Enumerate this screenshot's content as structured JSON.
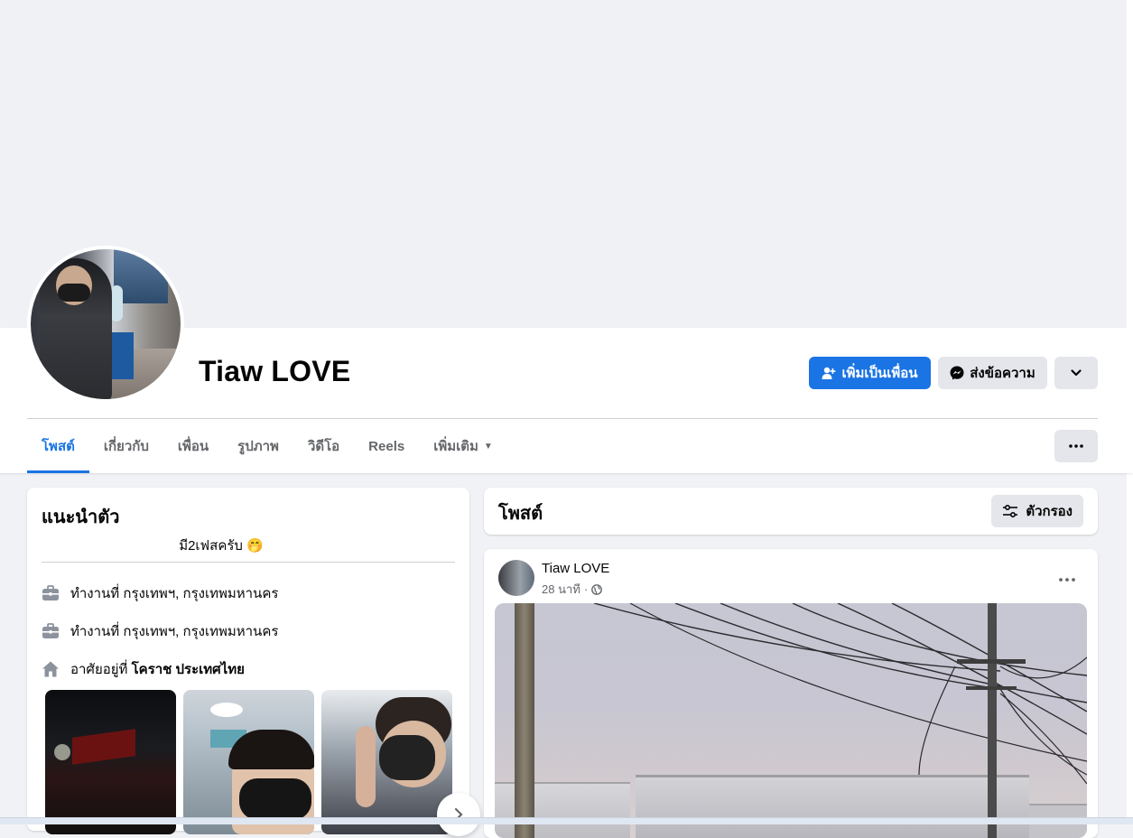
{
  "profile": {
    "name": "Tiaw LOVE",
    "add_friend_label": "เพิ่มเป็นเพื่อน",
    "message_label": "ส่งข้อความ"
  },
  "tabs": [
    {
      "label": "โพสต์",
      "active": true
    },
    {
      "label": "เกี่ยวกับ",
      "active": false
    },
    {
      "label": "เพื่อน",
      "active": false
    },
    {
      "label": "รูปภาพ",
      "active": false
    },
    {
      "label": "วิดีโอ",
      "active": false
    },
    {
      "label": "Reels",
      "active": false
    },
    {
      "label": "เพิ่มเติม",
      "active": false
    }
  ],
  "intro": {
    "title": "แนะนำตัว",
    "bio": "มี2เฟสครับ",
    "bio_emoji": "🤭",
    "work_1_prefix": "ทำงานที่",
    "work_1_place": "กรุงเทพฯ, กรุงเทพมหานคร",
    "work_2_prefix": "ทำงานที่",
    "work_2_place": "กรุงเทพฯ, กรุงเทพมหานคร",
    "home_prefix": "อาศัยอยู่ที่",
    "home_place": "โคราช ประเทศไทย"
  },
  "posts": {
    "title": "โพสต์",
    "filter_label": "ตัวกรอง",
    "post_author": "Tiaw LOVE",
    "post_time": "28 นาที",
    "post_dot": "·"
  },
  "colors": {
    "accent": "#1b74e4",
    "secondary_button": "#e4e6eb",
    "page_bg": "#f0f2f5"
  },
  "icons": {
    "add_friend": "person-plus-icon",
    "messenger": "messenger-icon",
    "chevron": "chevron-down-icon",
    "more": "more-dots-icon",
    "work": "briefcase-icon",
    "home": "home-icon",
    "filter": "filter-sliders-icon",
    "globe": "globe-icon",
    "next": "chevron-right-icon"
  }
}
